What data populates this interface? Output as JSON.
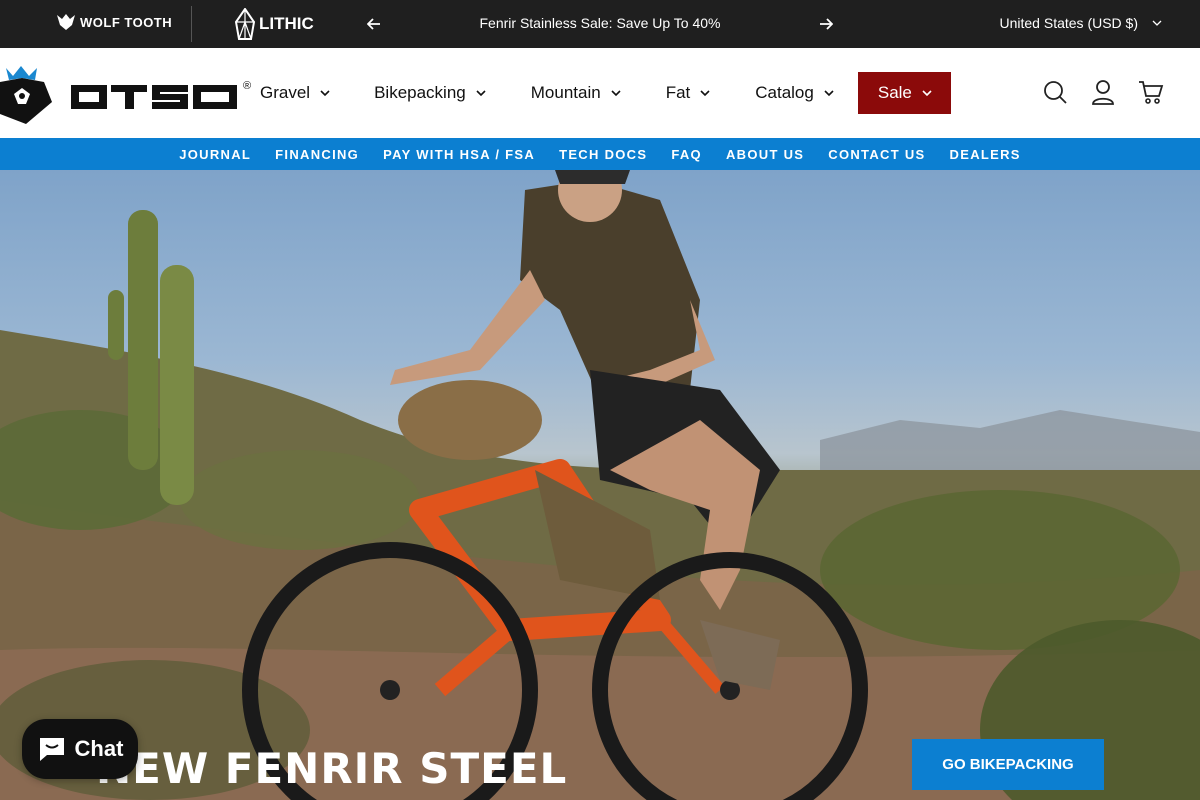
{
  "topbar": {
    "brands": {
      "wolf_tooth": "WOLF TOOTH",
      "lithic": "LITHIC"
    },
    "announcement": "Fenrir Stainless Sale: Save Up To 40%",
    "currency": "United States (USD $)",
    "icons": {
      "prev": "arrow-left-icon",
      "next": "arrow-right-icon",
      "currency_chevron": "chevron-down-icon"
    }
  },
  "header": {
    "logo_text": "OTSO",
    "registered": "®",
    "nav": [
      {
        "label": "Gravel"
      },
      {
        "label": "Bikepacking"
      },
      {
        "label": "Mountain"
      },
      {
        "label": "Fat"
      },
      {
        "label": "Catalog"
      },
      {
        "label": "Sale"
      }
    ],
    "icons": [
      "search-icon",
      "account-icon",
      "cart-icon"
    ]
  },
  "subnav": [
    "JOURNAL",
    "FINANCING",
    "PAY WITH HSA / FSA",
    "TECH DOCS",
    "FAQ",
    "ABOUT US",
    "CONTACT US",
    "DEALERS"
  ],
  "hero": {
    "title": "NEW FENRIR STEEL",
    "cta": "GO BIKEPACKING"
  },
  "chat": {
    "label": "Chat"
  },
  "colors": {
    "topbar": "#1f1f1f",
    "subnav": "#0c7fd1",
    "sale": "#8b0a0a",
    "cta": "#0c7fd1"
  }
}
